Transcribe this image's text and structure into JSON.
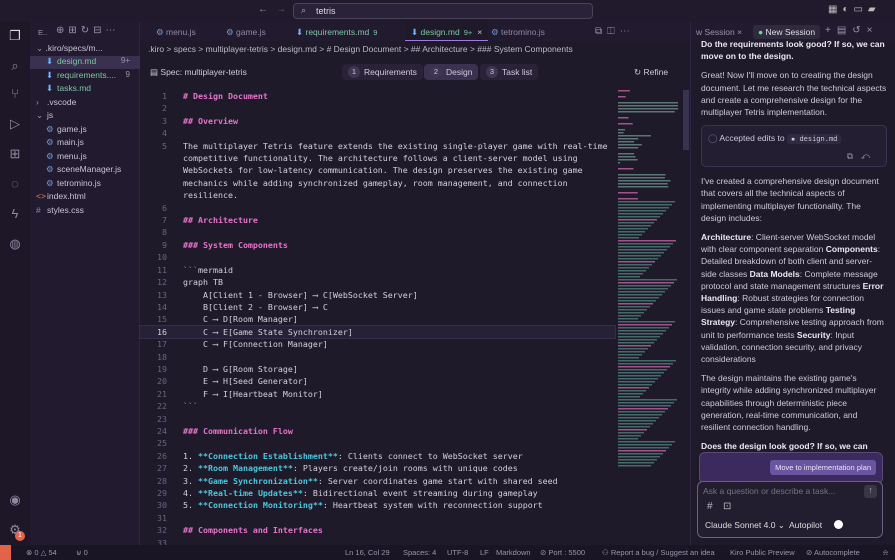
{
  "titlebar": {
    "search": "tetris"
  },
  "explorer": {
    "header": "E..",
    "root": ".kiro/specs/m...",
    "items": [
      {
        "label": "design.md",
        "badge": "9+",
        "depth": 2,
        "icon": "md",
        "sel": true
      },
      {
        "label": "requirements....",
        "badge": "9",
        "depth": 2,
        "icon": "md"
      },
      {
        "label": "tasks.md",
        "badge": "",
        "depth": 2,
        "icon": "md"
      },
      {
        "label": ".vscode",
        "badge": "",
        "depth": 1,
        "icon": "chev-r"
      },
      {
        "label": "js",
        "badge": "",
        "depth": 1,
        "icon": "chev-d"
      },
      {
        "label": "game.js",
        "badge": "",
        "depth": 2,
        "icon": "js"
      },
      {
        "label": "main.js",
        "badge": "",
        "depth": 2,
        "icon": "js"
      },
      {
        "label": "menu.js",
        "badge": "",
        "depth": 2,
        "icon": "js"
      },
      {
        "label": "sceneManager.js",
        "badge": "",
        "depth": 2,
        "icon": "js"
      },
      {
        "label": "tetromino.js",
        "badge": "",
        "depth": 2,
        "icon": "js"
      },
      {
        "label": "index.html",
        "badge": "",
        "depth": 1,
        "icon": "html"
      },
      {
        "label": "styles.css",
        "badge": "",
        "depth": 1,
        "icon": "css"
      }
    ]
  },
  "tabs": [
    {
      "label": "menu.js"
    },
    {
      "label": "game.js"
    },
    {
      "label": "requirements.md",
      "badge": "9"
    },
    {
      "label": "design.md",
      "badge": "9+",
      "active": true
    },
    {
      "label": "tetromino.js"
    }
  ],
  "breadcrumb": ".kiro > specs > multiplayer-tetris > design.md > # Design Document > ## Architecture > ### System Components",
  "spec": {
    "title": "Spec: multiplayer-tetris",
    "steps": [
      {
        "n": "1",
        "label": "Requirements"
      },
      {
        "n": "2",
        "label": "Design"
      },
      {
        "n": "3",
        "label": "Task list"
      }
    ],
    "refine": "Refine"
  },
  "code": [
    [
      [
        "h",
        "# Design Document"
      ]
    ],
    [],
    [
      [
        "h",
        "## Overview"
      ]
    ],
    [],
    [
      [
        "t",
        "The multiplayer Tetris feature extends the existing single-player game with real-time competitive functionality. The architecture follows a client-server model using WebSockets for low-latency communication. The design preserves the existing game mechanics while adding synchronized gameplay, room management, and connection resilience."
      ]
    ],
    [],
    [
      [
        "h",
        "## Architecture"
      ]
    ],
    [],
    [
      [
        "h",
        "### System Components"
      ]
    ],
    [],
    [
      [
        "m",
        "```"
      ],
      [
        "t",
        "mermaid"
      ]
    ],
    [
      [
        "t",
        "graph TB"
      ]
    ],
    [
      [
        "t",
        "    A[Client 1 - Browser] ⟶ C[WebSocket Server]"
      ]
    ],
    [
      [
        "t",
        "    B[Client 2 - Browser] ⟶ C"
      ]
    ],
    [
      [
        "t",
        "    C ⟶ D[Room Manager]"
      ]
    ],
    [
      [
        "t",
        "    C ⟶ E[Game State Synchronizer]"
      ]
    ],
    [
      [
        "t",
        "    C ⟶ F[Connection Manager]"
      ]
    ],
    [],
    [
      [
        "t",
        "    D ⟶ G[Room Storage]"
      ]
    ],
    [
      [
        "t",
        "    E ⟶ H[Seed Generator]"
      ]
    ],
    [
      [
        "t",
        "    F ⟶ I[Heartbeat Monitor]"
      ]
    ],
    [
      [
        "m",
        "```"
      ]
    ],
    [],
    [
      [
        "h",
        "### Communication Flow"
      ]
    ],
    [],
    [
      [
        "t",
        "1. "
      ],
      [
        "b",
        "**Connection Establishment**"
      ],
      [
        "t",
        ": Clients connect to WebSocket server"
      ]
    ],
    [
      [
        "t",
        "2. "
      ],
      [
        "b",
        "**Room Management**"
      ],
      [
        "t",
        ": Players create/join rooms with unique codes"
      ]
    ],
    [
      [
        "t",
        "3. "
      ],
      [
        "b",
        "**Game Synchronization**"
      ],
      [
        "t",
        ": Server coordinates game start with shared seed"
      ]
    ],
    [
      [
        "t",
        "4. "
      ],
      [
        "b",
        "**Real-time Updates**"
      ],
      [
        "t",
        ": Bidirectional event streaming during gameplay"
      ]
    ],
    [
      [
        "t",
        "5. "
      ],
      [
        "b",
        "**Connection Monitoring**"
      ],
      [
        "t",
        ": Heartbeat system with reconnection support"
      ]
    ],
    [],
    [
      [
        "h",
        "## Components and Interfaces"
      ]
    ],
    []
  ],
  "current_line": 16,
  "chat": {
    "tabs": [
      {
        "label": "w Session"
      },
      {
        "label": "New Session",
        "active": true
      }
    ],
    "top": "Do the requirements look good? If so, we can move on to the design.",
    "intro": "Great! Now I'll move on to creating the design document. Let me research the technical aspects and create a comprehensive design for the multiplayer Tetris implementation.",
    "accepted": "Accepted edits to",
    "accepted_file": "design.md",
    "summary": "I've created a comprehensive design document that covers all the technical aspects of implementing multiplayer functionality. The design includes:",
    "points": [
      [
        "Architecture",
        ": Client-server WebSocket model with clear component separation "
      ],
      [
        "Components",
        ": Detailed breakdown of both client and server-side classes "
      ],
      [
        "Data Models",
        ": Complete message protocol and state management structures "
      ],
      [
        "Error Handling",
        ": Robust strategies for connection issues and game state problems "
      ],
      [
        "Testing Strategy",
        ": Comprehensive testing approach from unit to performance tests "
      ],
      [
        "Security",
        ": Input validation, connection security, and privacy considerations"
      ]
    ],
    "maintains": "The design maintains the existing game's integrity while adding synchronized multiplayer capabilities through deterministic piece generation, real-time communication, and resilient connection handling.",
    "question": "Does the design look good? If so, we can move on to the implementation plan.",
    "plan_button": "Move to implementation plan",
    "placeholder": "Ask a question or describe a task...",
    "model": "Claude Sonnet 4.0",
    "autopilot": "Autopilot"
  },
  "status": {
    "errors": "0",
    "warnings": "54",
    "ports": "0",
    "position": "Ln 16, Col 29",
    "spaces": "Spaces: 4",
    "encoding": "UTF-8",
    "eol": "LF",
    "lang": "Markdown",
    "port": "Port : 5500",
    "report": "Report a bug / Suggest an idea",
    "preview": "Kiro Public Preview",
    "autocomplete": "Autocomplete",
    "notif": "1"
  }
}
